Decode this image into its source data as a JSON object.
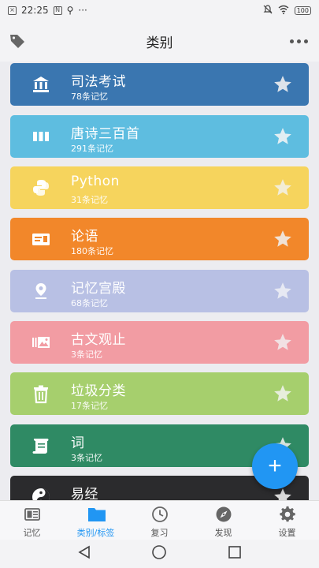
{
  "status_bar": {
    "time": "22:25",
    "battery": "100"
  },
  "header": {
    "title": "类别"
  },
  "categories": [
    {
      "title": "司法考试",
      "count": "78条记忆",
      "color": "#3a76b0",
      "icon": "bank-icon",
      "star_color": "#dde3ea"
    },
    {
      "title": "唐诗三百首",
      "count": "291条记忆",
      "color": "#5ebde0",
      "icon": "book-columns-icon",
      "star_color": "#e1eef3"
    },
    {
      "title": "Python",
      "count": "31条记忆",
      "color": "#f6d45d",
      "icon": "python-icon",
      "star_color": "#f3edd5"
    },
    {
      "title": "论语",
      "count": "180条记忆",
      "color": "#f2872a",
      "icon": "id-card-icon",
      "star_color": "#f0e2d6"
    },
    {
      "title": "记忆宫殿",
      "count": "68条记忆",
      "color": "#b8c0e4",
      "icon": "location-pin-icon",
      "star_color": "#e7e9f3"
    },
    {
      "title": "古文观止",
      "count": "3条记忆",
      "color": "#f29ca3",
      "icon": "image-gallery-icon",
      "star_color": "#f2e1e3"
    },
    {
      "title": "垃圾分类",
      "count": "17条记忆",
      "color": "#a6cf6d",
      "icon": "trash-icon",
      "star_color": "#e7eedc"
    },
    {
      "title": "词",
      "count": "3条记忆",
      "color": "#2f8a64",
      "icon": "scroll-icon",
      "star_color": "#d9e4df"
    },
    {
      "title": "易经",
      "count": "",
      "color": "#2b2b2d",
      "icon": "yin-yang-icon",
      "star_color": "#d9d9d9"
    }
  ],
  "fab": {
    "label": "+"
  },
  "bottom_nav": [
    {
      "label": "记忆",
      "icon": "memory-card-icon"
    },
    {
      "label": "类别/标签",
      "icon": "folder-icon"
    },
    {
      "label": "复习",
      "icon": "clock-icon"
    },
    {
      "label": "发现",
      "icon": "compass-icon"
    },
    {
      "label": "设置",
      "icon": "gear-icon"
    }
  ],
  "colors": {
    "accent": "#2196f3",
    "inactive": "#666666"
  }
}
